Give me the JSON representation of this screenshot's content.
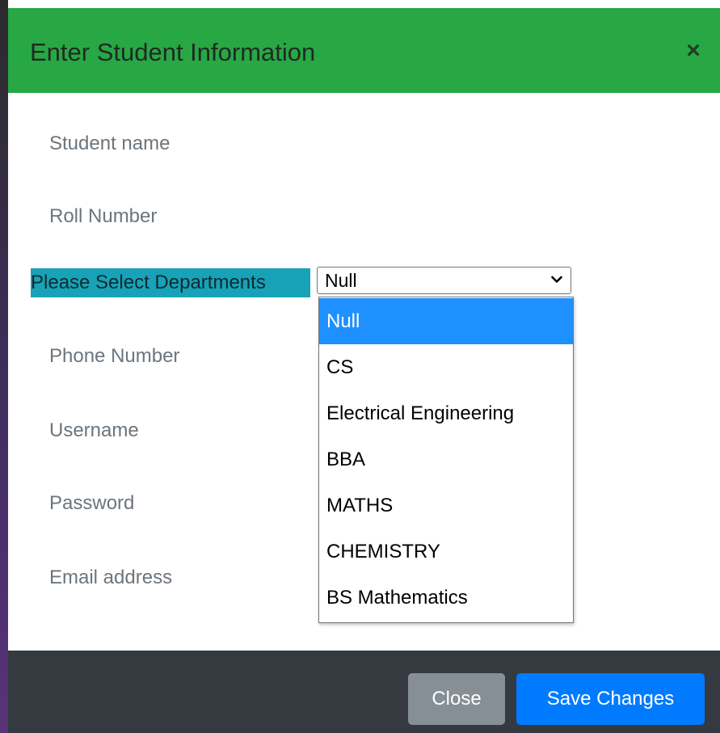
{
  "modal": {
    "title": "Enter Student Information",
    "close_symbol": "×"
  },
  "form": {
    "student_name_label": "Student name",
    "roll_number_label": "Roll Number",
    "department_label": "Please Select Departments",
    "phone_number_label": "Phone Number",
    "username_label": "Username",
    "password_label": "Password",
    "email_label": "Email address"
  },
  "department_select": {
    "selected_value": "Null",
    "options": [
      {
        "label": "Null",
        "selected": true
      },
      {
        "label": "CS",
        "selected": false
      },
      {
        "label": "Electrical Engineering",
        "selected": false
      },
      {
        "label": "BBA",
        "selected": false
      },
      {
        "label": "MATHS",
        "selected": false
      },
      {
        "label": "CHEMISTRY",
        "selected": false
      },
      {
        "label": "BS Mathematics",
        "selected": false
      }
    ]
  },
  "footer": {
    "close_label": "Close",
    "save_label": "Save Changes"
  },
  "colors": {
    "header_bg": "#28a745",
    "label_highlight_bg": "#17a2b8",
    "footer_bg": "#343a40",
    "close_button_bg": "#868e96",
    "save_button_bg": "#007bff",
    "option_selected_bg": "#1e90ff"
  },
  "icons": {
    "dismiss": "close-icon",
    "select_arrow": "chevron-down-icon"
  }
}
